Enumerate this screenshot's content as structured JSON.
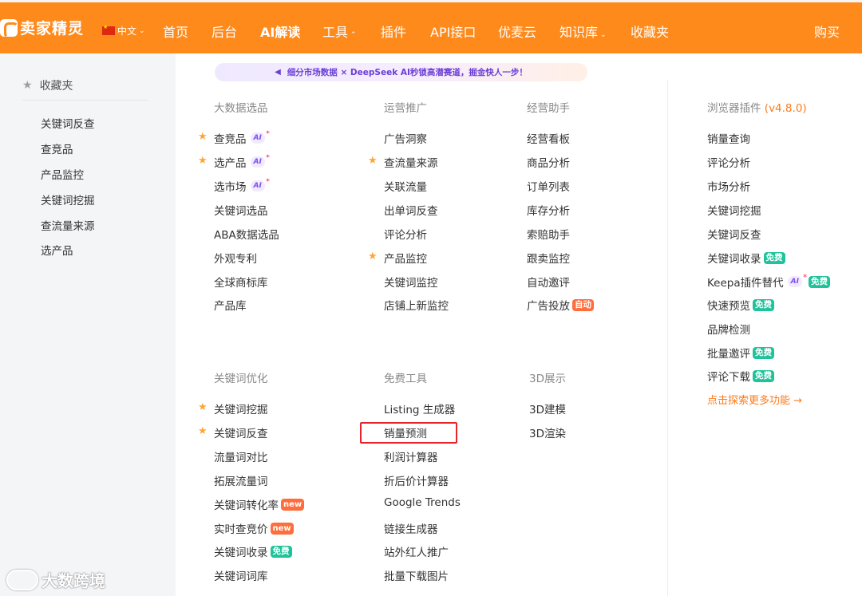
{
  "nav": {
    "logo": "卖家精灵",
    "lang": "中文",
    "items": [
      "首页",
      "后台",
      "AI解读",
      "工具",
      "插件",
      "API接口",
      "优麦云",
      "知识库",
      "收藏夹"
    ],
    "buy": "购买"
  },
  "sidebar": {
    "title": "收藏夹",
    "items": [
      "关键词反查",
      "查竞品",
      "产品监控",
      "关键词挖掘",
      "查流量来源",
      "选产品"
    ]
  },
  "banner": "细分市场数据 × DeepSeek AI秒锁高潜赛道，掘金快人一步！",
  "sections": {
    "big_data": {
      "title": "大数据选品",
      "items": [
        "查竞品",
        "选产品",
        "选市场",
        "关键词选品",
        "ABA数据选品",
        "外观专利",
        "全球商标库",
        "产品库"
      ]
    },
    "promotion": {
      "title": "运营推广",
      "items": [
        "广告洞察",
        "查流量来源",
        "关联流量",
        "出单词反查",
        "评论分析",
        "产品监控",
        "关键词监控",
        "店铺上新监控"
      ]
    },
    "assistant": {
      "title": "经营助手",
      "items": [
        "经营看板",
        "商品分析",
        "订单列表",
        "库存分析",
        "索赔助手",
        "跟卖监控",
        "自动邀评",
        "广告投放"
      ],
      "auto_tag": "自动"
    },
    "keywords": {
      "title": "关键词优化",
      "items": [
        "关键词挖掘",
        "关键词反查",
        "流量词对比",
        "拓展流量词",
        "关键词转化率",
        "实时查竞价",
        "关键词收录",
        "关键词词库"
      ]
    },
    "free_tools": {
      "title": "免费工具",
      "items": [
        "Listing 生成器",
        "销量预测",
        "利润计算器",
        "折后价计算器",
        "Google Trends",
        "链接生成器",
        "站外红人推广",
        "批量下载图片"
      ]
    },
    "display3d": {
      "title": "3D展示",
      "items": [
        "3D建模",
        "3D渲染"
      ]
    },
    "plugin": {
      "title": "浏览器插件",
      "version": "(v4.8.0)",
      "items": [
        "销量查询",
        "评论分析",
        "市场分析",
        "关键词挖掘",
        "关键词反查",
        "关键词收录",
        "Keepa插件替代",
        "快速预览",
        "品牌检测",
        "批量邀评",
        "评论下载"
      ],
      "more": "点击探索更多功能 →"
    }
  },
  "tags": {
    "ai": "AI",
    "new": "new",
    "free": "免费"
  },
  "watermark": "大数跨境"
}
